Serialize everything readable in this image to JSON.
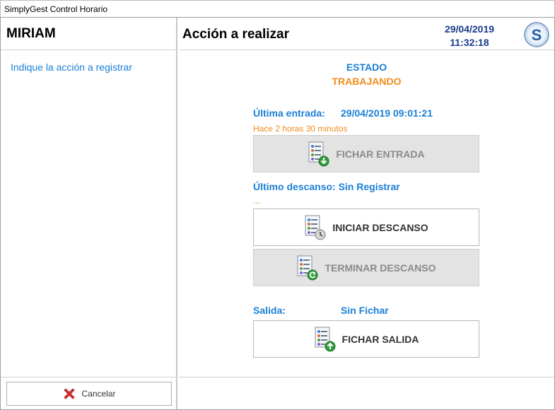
{
  "window": {
    "title": "SimplyGest Control Horario"
  },
  "left": {
    "user_name": "MIRIAM",
    "instruction": "Indique la acción a registrar",
    "cancel_label": "Cancelar"
  },
  "right": {
    "title": "Acción a realizar",
    "date": "29/04/2019",
    "time": "11:32:18",
    "estado_label": "ESTADO",
    "estado_value": "TRABAJANDO",
    "ultima_entrada_label": "Última entrada:",
    "ultima_entrada_value": "29/04/2019 09:01:21",
    "ultima_entrada_ago": "Hace 2 horas 30 minutos",
    "fichar_entrada_label": "FICHAR ENTRADA",
    "ultimo_descanso_label": "Último descanso: Sin Registrar",
    "ultimo_descanso_sub": "...",
    "iniciar_descanso_label": "INICIAR DESCANSO",
    "terminar_descanso_label": "TERMINAR DESCANSO",
    "salida_label": "Salida:",
    "salida_value": "Sin Fichar",
    "fichar_salida_label": "FICHAR SALIDA"
  },
  "colors": {
    "accent_blue": "#1a7fd6",
    "status_orange": "#f08c1c",
    "datetime_blue": "#1a3a8c"
  },
  "icons": [
    "user-list-arrow-down-icon",
    "user-list-clock-icon",
    "user-list-return-icon",
    "user-list-arrow-up-icon",
    "cancel-x-icon",
    "app-logo-icon"
  ]
}
